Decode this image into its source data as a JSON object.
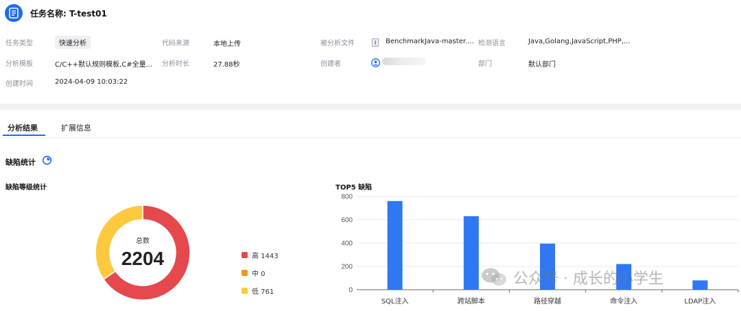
{
  "header": {
    "title_label": "任务名称:",
    "title_value": "T-test01"
  },
  "info": {
    "task_type_label": "任务类型",
    "task_type_value": "快速分析",
    "code_source_label": "代码来源",
    "code_source_value": "本地上传",
    "analyzed_file_label": "被分析文件",
    "analyzed_file_value": "BenchmarkJava-master....",
    "detect_lang_label": "检测语言",
    "detect_lang_value": "Java,Golang,JavaScript,PHP,...",
    "template_label": "分析模板",
    "template_value": "C/C++默认规则模板,C#全量...",
    "duration_label": "分析时长",
    "duration_value": "27.88秒",
    "creator_label": "创建者",
    "dept_label": "部门",
    "dept_value": "默认部门",
    "created_label": "创建时间",
    "created_value": "2024-04-09 10:03:22"
  },
  "tabs": [
    {
      "label": "分析结果",
      "active": true
    },
    {
      "label": "扩展信息",
      "active": false
    }
  ],
  "defects": {
    "title": "缺陷统计",
    "level_title": "缺陷等级统计",
    "top5_title": "TOP5 缺陷"
  },
  "chart_data": [
    {
      "type": "pie",
      "variant": "donut",
      "center_label": "总数",
      "center_value": "2204",
      "slices": [
        {
          "label": "高",
          "value": 1443,
          "color": "#e5484d"
        },
        {
          "label": "中",
          "value": 0,
          "color": "#f5931f"
        },
        {
          "label": "低",
          "value": 761,
          "color": "#ffc93f"
        }
      ],
      "legend_text": [
        "高 1443",
        "中 0",
        "低 761"
      ],
      "legend_position": "right"
    },
    {
      "type": "bar",
      "title": "TOP5 缺陷",
      "categories": [
        "SQL注入",
        "跨站脚本",
        "路径穿越",
        "命令注入",
        "LDAP注入"
      ],
      "values": [
        760,
        630,
        395,
        220,
        80
      ],
      "ylim": [
        0,
        800
      ],
      "yticks": [
        0,
        200,
        400,
        600,
        800
      ],
      "grid": true,
      "color": "#2f78f2"
    }
  ],
  "watermark": {
    "text": "公众号 · 成长的小学生"
  }
}
